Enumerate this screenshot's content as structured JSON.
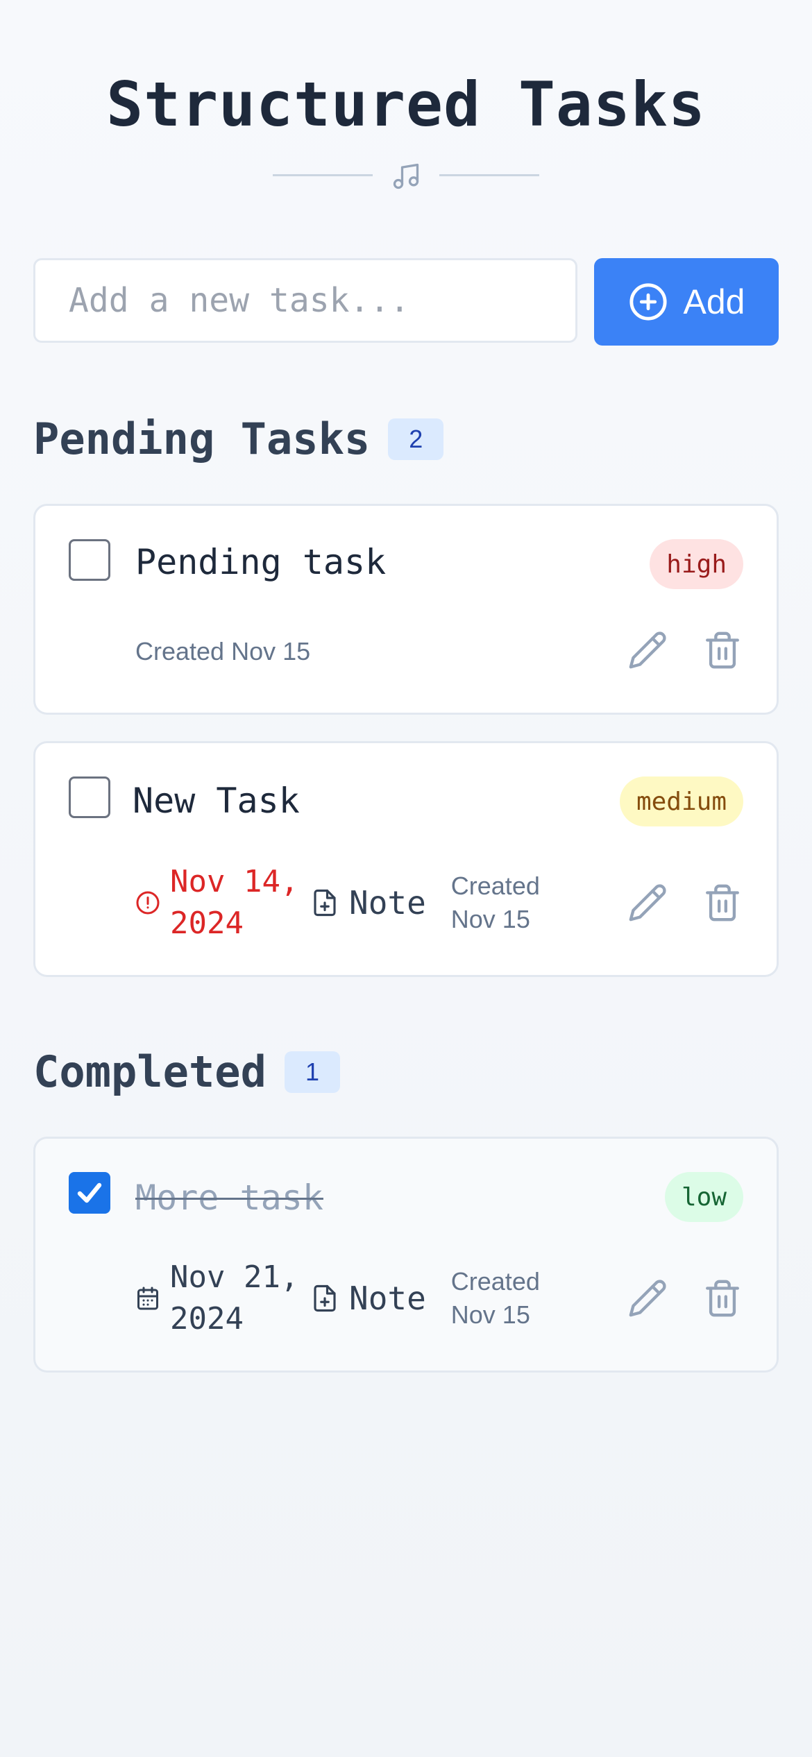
{
  "header": {
    "title": "Structured Tasks",
    "divider_icon": "music-note-icon"
  },
  "new_task": {
    "placeholder": "Add a new task...",
    "value": "",
    "add_label": "Add",
    "add_icon": "plus-circle-icon"
  },
  "pending": {
    "title": "Pending Tasks",
    "count": "2",
    "tasks": [
      {
        "title": "Pending task",
        "priority": "high",
        "created": "Created Nov 15",
        "completed": false
      },
      {
        "title": "New Task",
        "priority": "medium",
        "due": "Nov 14, 2024",
        "due_status": "overdue",
        "note_label": "Note",
        "created": "Created Nov 15",
        "completed": false
      }
    ]
  },
  "completed": {
    "title": "Completed",
    "count": "1",
    "tasks": [
      {
        "title": "More task",
        "priority": "low",
        "due": "Nov 21, 2024",
        "note_label": "Note",
        "created": "Created Nov 15",
        "completed": true
      }
    ]
  },
  "colors": {
    "accent": "#3b82f6",
    "overdue": "#dc2626",
    "checkbox_checked": "#1a73e8",
    "priority_high_bg": "#fee2e2",
    "priority_medium_bg": "#fef9c3",
    "priority_low_bg": "#dcfce7"
  }
}
